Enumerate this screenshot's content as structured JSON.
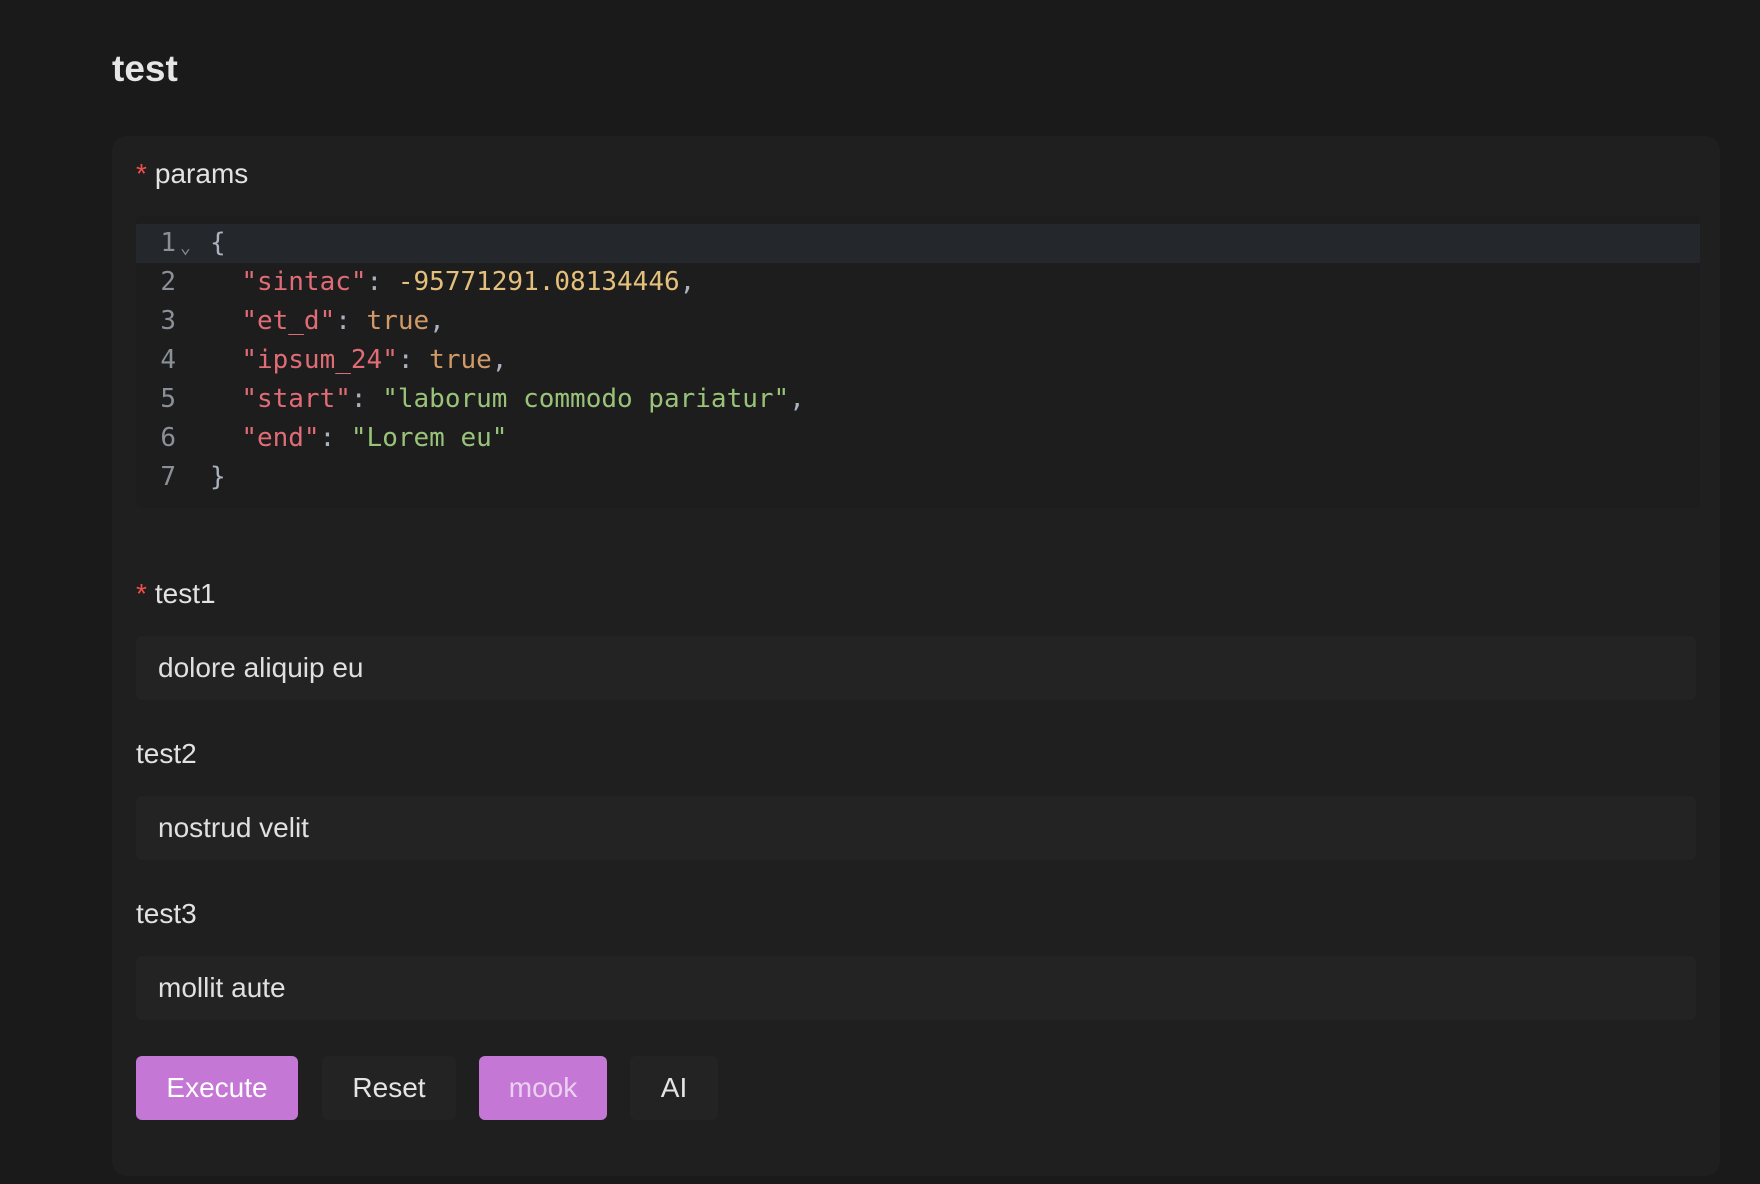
{
  "page": {
    "title": "test"
  },
  "form": {
    "params": {
      "label": "params",
      "required_mark": "*",
      "editor": {
        "active_line": 1,
        "lines": [
          {
            "num": "1",
            "fold": "⌄",
            "tokens": [
              {
                "t": "{",
                "c": "punc"
              }
            ]
          },
          {
            "num": "2",
            "tokens": [
              {
                "t": "  ",
                "c": "punc"
              },
              {
                "t": "\"sintac\"",
                "c": "key"
              },
              {
                "t": ": ",
                "c": "punc"
              },
              {
                "t": "-95771291.08134446",
                "c": "num"
              },
              {
                "t": ",",
                "c": "punc"
              }
            ]
          },
          {
            "num": "3",
            "tokens": [
              {
                "t": "  ",
                "c": "punc"
              },
              {
                "t": "\"et_d\"",
                "c": "key"
              },
              {
                "t": ": ",
                "c": "punc"
              },
              {
                "t": "true",
                "c": "bool"
              },
              {
                "t": ",",
                "c": "punc"
              }
            ]
          },
          {
            "num": "4",
            "tokens": [
              {
                "t": "  ",
                "c": "punc"
              },
              {
                "t": "\"ipsum_24\"",
                "c": "key"
              },
              {
                "t": ": ",
                "c": "punc"
              },
              {
                "t": "true",
                "c": "bool"
              },
              {
                "t": ",",
                "c": "punc"
              }
            ]
          },
          {
            "num": "5",
            "tokens": [
              {
                "t": "  ",
                "c": "punc"
              },
              {
                "t": "\"start\"",
                "c": "key"
              },
              {
                "t": ": ",
                "c": "punc"
              },
              {
                "t": "\"laborum commodo pariatur\"",
                "c": "str"
              },
              {
                "t": ",",
                "c": "punc"
              }
            ]
          },
          {
            "num": "6",
            "tokens": [
              {
                "t": "  ",
                "c": "punc"
              },
              {
                "t": "\"end\"",
                "c": "key"
              },
              {
                "t": ": ",
                "c": "punc"
              },
              {
                "t": "\"Lorem eu\"",
                "c": "str"
              }
            ]
          },
          {
            "num": "7",
            "tokens": [
              {
                "t": "}",
                "c": "punc"
              }
            ]
          }
        ]
      }
    },
    "test1": {
      "label": "test1",
      "required_mark": "*",
      "value": "dolore aliquip eu"
    },
    "test2": {
      "label": "test2",
      "value": "nostrud velit"
    },
    "test3": {
      "label": "test3",
      "value": "mollit aute"
    }
  },
  "actions": {
    "execute": "Execute",
    "reset": "Reset",
    "mook": "mook",
    "ai": "AI"
  },
  "colors": {
    "accent": "#c477d4",
    "required": "#f0504c",
    "json_key": "#e06c75",
    "json_number": "#e5c07b",
    "json_boolean": "#d19a66",
    "json_string": "#98c379"
  }
}
